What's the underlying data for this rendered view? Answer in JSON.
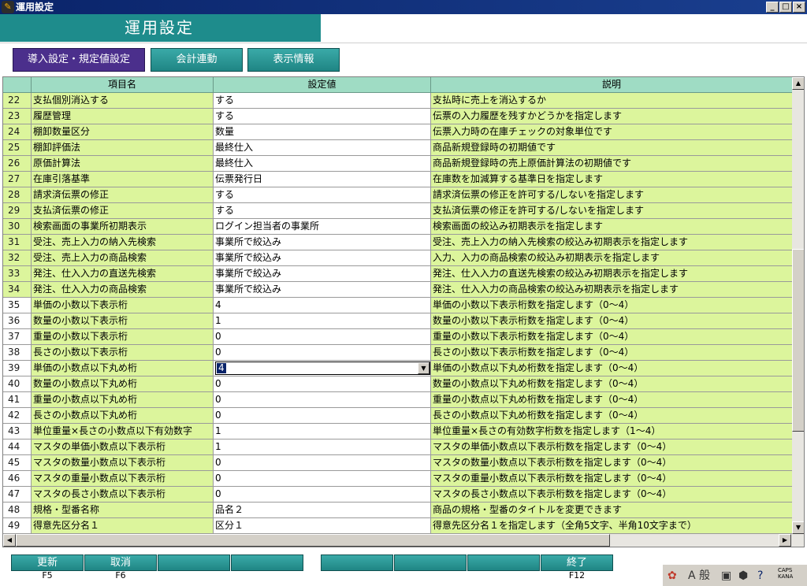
{
  "window": {
    "title": "運用設定",
    "app_icon": "app-icon",
    "controls": [
      "_",
      "□",
      "×"
    ]
  },
  "header": {
    "title": "運用設定"
  },
  "tabs": [
    {
      "label": "導入設定・規定値設定",
      "active": true
    },
    {
      "label": "会計連動",
      "active": false
    },
    {
      "label": "表示情報",
      "active": false
    }
  ],
  "grid": {
    "columns": [
      "項目名",
      "設定値",
      "説明"
    ],
    "rows": [
      {
        "num": "22",
        "name": "支払個別消込する",
        "value": "する",
        "desc": "支払時に売上を消込するか"
      },
      {
        "num": "23",
        "name": "履歴管理",
        "value": "する",
        "desc": "伝票の入力履歴を残すかどうかを指定します"
      },
      {
        "num": "24",
        "name": "棚卸数量区分",
        "value": "数量",
        "desc": "伝票入力時の在庫チェックの対象単位です"
      },
      {
        "num": "25",
        "name": "棚卸評価法",
        "value": "最終仕入",
        "desc": "商品新規登録時の初期値です"
      },
      {
        "num": "26",
        "name": "原価計算法",
        "value": "最終仕入",
        "desc": "商品新規登録時の売上原価計算法の初期値です"
      },
      {
        "num": "27",
        "name": "在庫引落基準",
        "value": "伝票発行日",
        "desc": "在庫数を加減算する基準日を指定します"
      },
      {
        "num": "28",
        "name": "請求済伝票の修正",
        "value": "する",
        "desc": "請求済伝票の修正を許可する/しないを指定します"
      },
      {
        "num": "29",
        "name": "支払済伝票の修正",
        "value": "する",
        "desc": "支払済伝票の修正を許可する/しないを指定します"
      },
      {
        "num": "30",
        "name": "検索画面の事業所初期表示",
        "value": "ログイン担当者の事業所",
        "desc": "検索画面の絞込み初期表示を指定します"
      },
      {
        "num": "31",
        "name": "受注、売上入力の納入先検索",
        "value": "事業所で絞込み",
        "desc": "受注、売上入力の納入先検索の絞込み初期表示を指定します"
      },
      {
        "num": "32",
        "name": "受注、売上入力の商品検索",
        "value": "事業所で絞込み",
        "desc": "入力、入力の商品検索の絞込み初期表示を指定します"
      },
      {
        "num": "33",
        "name": "発注、仕入入力の直送先検索",
        "value": "事業所で絞込み",
        "desc": "発注、仕入入力の直送先検索の絞込み初期表示を指定します"
      },
      {
        "num": "34",
        "name": "発注、仕入入力の商品検索",
        "value": "事業所で絞込み",
        "desc": "発注、仕入入力の商品検索の絞込み初期表示を指定します"
      },
      {
        "num": "35",
        "name": "単価の小数以下表示桁",
        "value": "4",
        "desc": "単価の小数以下表示桁数を指定します（0～4）"
      },
      {
        "num": "36",
        "name": "数量の小数以下表示桁",
        "value": "1",
        "desc": "数量の小数以下表示桁数を指定します（0～4）"
      },
      {
        "num": "37",
        "name": "重量の小数以下表示桁",
        "value": "0",
        "desc": "重量の小数以下表示桁数を指定します（0～4）"
      },
      {
        "num": "38",
        "name": "長さの小数以下表示桁",
        "value": "0",
        "desc": "長さの小数以下表示桁数を指定します（0～4）"
      },
      {
        "num": "39",
        "name": "単価の小数点以下丸め桁",
        "value": "4",
        "desc": "単価の小数点以下丸め桁数を指定します（0～4）",
        "editing": true
      },
      {
        "num": "40",
        "name": "数量の小数点以下丸め桁",
        "value": "0",
        "desc": "数量の小数点以下丸め桁数を指定します（0～4）"
      },
      {
        "num": "41",
        "name": "重量の小数点以下丸め桁",
        "value": "0",
        "desc": "重量の小数点以下丸め桁数を指定します（0～4）"
      },
      {
        "num": "42",
        "name": "長さの小数点以下丸め桁",
        "value": "0",
        "desc": "長さの小数点以下丸め桁数を指定します（0～4）"
      },
      {
        "num": "43",
        "name": "単位重量×長さの小数点以下有効数字",
        "value": "1",
        "desc": "単位重量×長さの有効数字桁数を指定します（1～4）"
      },
      {
        "num": "44",
        "name": "マスタの単価小数点以下表示桁",
        "value": "1",
        "desc": "マスタの単価小数点以下表示桁数を指定します（0～4）"
      },
      {
        "num": "45",
        "name": "マスタの数量小数点以下表示桁",
        "value": "0",
        "desc": "マスタの数量小数点以下表示桁数を指定します（0～4）"
      },
      {
        "num": "46",
        "name": "マスタの重量小数点以下表示桁",
        "value": "0",
        "desc": "マスタの重量小数点以下表示桁数を指定します（0～4）"
      },
      {
        "num": "47",
        "name": "マスタの長さ小数点以下表示桁",
        "value": "0",
        "desc": "マスタの長さ小数点以下表示桁数を指定します（0～4）"
      },
      {
        "num": "48",
        "name": "規格・型番名称",
        "value": "品名２",
        "desc": "商品の規格・型番のタイトルを変更できます"
      },
      {
        "num": "49",
        "name": "得意先区分名１",
        "value": "区分１",
        "desc": "得意先区分名１を指定します（全角5文字、半角10文字まで）"
      }
    ]
  },
  "function_keys": [
    {
      "label": "更新",
      "key": "F5"
    },
    {
      "label": "取消",
      "key": "F6"
    },
    {
      "label": "",
      "key": ""
    },
    {
      "label": "",
      "key": ""
    },
    {
      "label": "",
      "key": ""
    },
    {
      "label": "",
      "key": ""
    },
    {
      "label": "",
      "key": ""
    },
    {
      "label": "終了",
      "key": "F12"
    }
  ],
  "tray": {
    "ime_text": "A 般",
    "caps": "CAPS",
    "kana": "KANA"
  },
  "colors": {
    "accent_teal": "#1e8c8c",
    "active_tab": "#4b2f8c",
    "row_lime": "#dcf59c",
    "header_mint": "#9fdcc4"
  }
}
